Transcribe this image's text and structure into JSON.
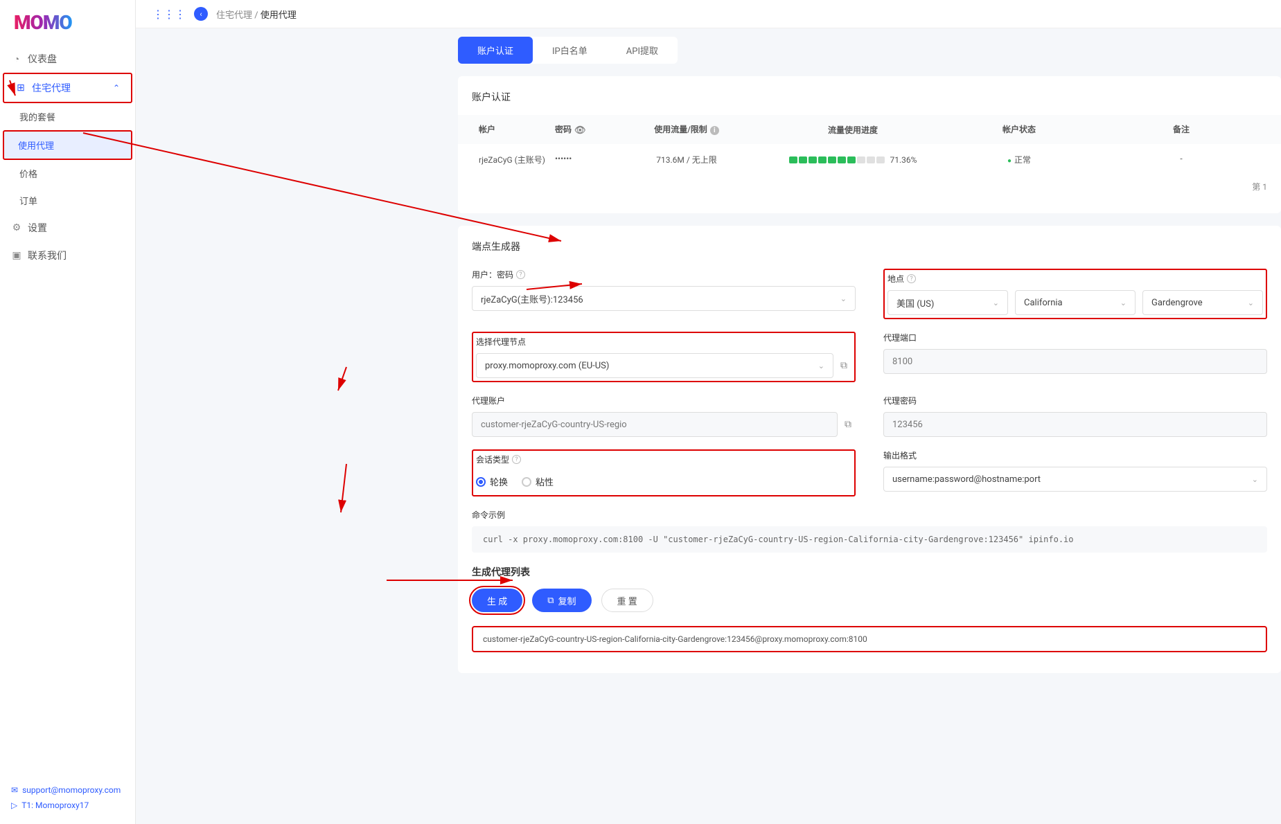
{
  "logo": "MOMO",
  "breadcrumb": {
    "parent": "住宅代理",
    "current": "使用代理"
  },
  "sidebar": {
    "items": [
      {
        "label": "仪表盘"
      },
      {
        "label": "住宅代理"
      },
      {
        "label": "我的套餐"
      },
      {
        "label": "使用代理"
      },
      {
        "label": "价格"
      },
      {
        "label": "订单"
      },
      {
        "label": "设置"
      },
      {
        "label": "联系我们"
      }
    ],
    "footer": {
      "email": "support@momoproxy.com",
      "tg": "T1: Momoproxy17"
    }
  },
  "tabs": {
    "t1": "账户认证",
    "t2": "IP白名单",
    "t3": "API提取"
  },
  "accountAuth": {
    "title": "账户认证",
    "headers": {
      "acct": "帐户",
      "pwd": "密码",
      "usage": "使用流量/限制",
      "progress": "流量使用进度",
      "status": "帐户状态",
      "remark": "备注"
    },
    "row": {
      "acct": "rjeZaCyG (主账号)",
      "pwd": "••••••",
      "usage": "713.6M / 无上限",
      "progressPct": "71.36%",
      "status": "正常",
      "remark": "-"
    },
    "pageFoot": "第 1"
  },
  "generator": {
    "title": "端点生成器",
    "labels": {
      "userpwd": "用户：密码",
      "location": "地点",
      "proxyNode": "选择代理节点",
      "proxyPort": "代理端口",
      "proxyAcct": "代理账户",
      "proxyPwd": "代理密码",
      "sessionType": "会话类型",
      "outputFmt": "输出格式",
      "cmdExample": "命令示例",
      "genList": "生成代理列表"
    },
    "values": {
      "userpwd": "rjeZaCyG(主账号):123456",
      "country": "美国 (US)",
      "state": "California",
      "city": "Gardengrove",
      "proxyNode": "proxy.momoproxy.com (EU-US)",
      "proxyPort": "8100",
      "proxyAcct": "customer-rjeZaCyG-country-US-regio",
      "proxyPwd": "123456",
      "sessionRotate": "轮换",
      "sessionSticky": "粘性",
      "outputFmt": "username:password@hostname:port",
      "cmd": "curl -x proxy.momoproxy.com:8100 -U \"customer-rjeZaCyG-country-US-region-California-city-Gardengrove:123456\" ipinfo.io",
      "output": "customer-rjeZaCyG-country-US-region-California-city-Gardengrove:123456@proxy.momoproxy.com:8100"
    },
    "buttons": {
      "generate": "生 成",
      "copy": "复制",
      "reset": "重 置"
    }
  }
}
